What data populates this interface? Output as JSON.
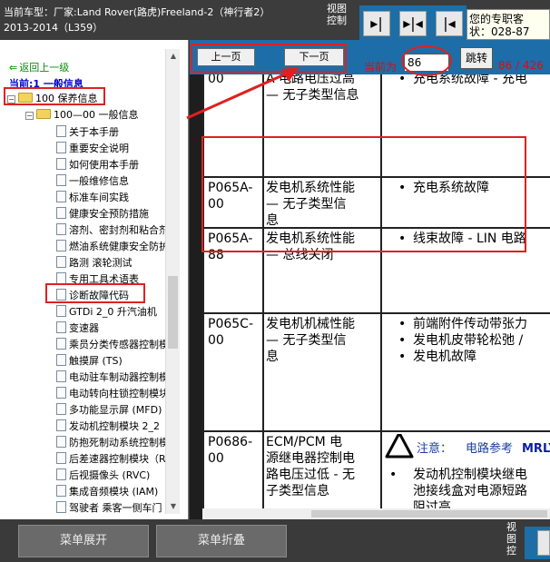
{
  "header": {
    "line1": "当前车型：厂家:Land Rover(路虎)Freeland-2（神行者2）",
    "line2": "2013-2014（L359）",
    "view_control": "视图控制",
    "tooltip_line1": "您的专职客",
    "tooltip_line2": "状：028-87",
    "nav_buttons": [
      "right-arrow",
      "split-arrows",
      "left-arrow"
    ]
  },
  "sidebar": {
    "back_label": "返回上一级",
    "current_label": "当前:1 一般信息",
    "root_folder": "100 保养信息",
    "sub_folder": "100—00 一般信息",
    "items": [
      "关于本手册",
      "重要安全说明",
      "如何使用本手册",
      "一般维修信息",
      "标准车间实践",
      "健康安全预防措施",
      "溶剂、密封剂和粘合剂",
      "燃油系统健康安全防护",
      "路测 滚轮测试",
      "专用工具术语表",
      "诊断故障代码",
      "GTDi 2_0 升汽油机",
      "变速器",
      "乘员分类传感器控制模块",
      "触摸屏 (TS)",
      "电动驻车制动器控制模块",
      "电动转向柱锁控制模块",
      "多功能显示屏 (MFD)",
      "发动机控制模块 2_2",
      "防抱死制动系统控制模块",
      "后差速器控制模块（RD",
      "后视摄像头 (RVC)",
      "集成音频模块 (IAM)",
      "驾驶者 乘客一侧车门"
    ]
  },
  "toolbar": {
    "prev_label": "上一页",
    "next_label": "下一页",
    "current_label": "当前为",
    "page_value": "86",
    "jump_label": "跳转",
    "page_count": "86 / 426"
  },
  "document": {
    "rows": [
      {
        "code": "00",
        "desc": [
          "A 电路电压过高",
          "— 无子类型信息"
        ],
        "causes": [
          "充电系统故障 - 充电"
        ]
      },
      {
        "code": "P065A-00",
        "desc": [
          "发电机系统性能",
          "— 无子类型信",
          "息"
        ],
        "causes": [
          "充电系统故障"
        ]
      },
      {
        "code": "P065A-88",
        "desc": [
          "发电机系统性能",
          "— 总线关闭"
        ],
        "causes": [
          "线束故障 - LIN 电路"
        ]
      },
      {
        "code": "P065C-00",
        "desc": [
          "发电机机械性能",
          "— 无子类型信",
          "息"
        ],
        "causes": [
          "前端附件传动带张力",
          "发电机皮带轮松弛 /",
          "发电机故障"
        ]
      },
      {
        "code": "P0686-00",
        "desc": [
          "ECM/PCM 电",
          "源继电器控制电",
          "路电压过低 - 无",
          "子类型信息"
        ],
        "note_prefix": "注意：",
        "note_ref": "电路参考",
        "note_code": "MRLY",
        "causes": [
          "发动机控制模块继电",
          "池接线盒对电源短路",
          "阻过高"
        ]
      }
    ]
  },
  "bottom": {
    "expand_label": "菜单展开",
    "collapse_label": "菜单折叠",
    "view_control": "视图控"
  },
  "colors": {
    "toolbar_blue": "#1d6ea8",
    "annotation_red": "#e02020",
    "page_count_red": "#d21010"
  }
}
